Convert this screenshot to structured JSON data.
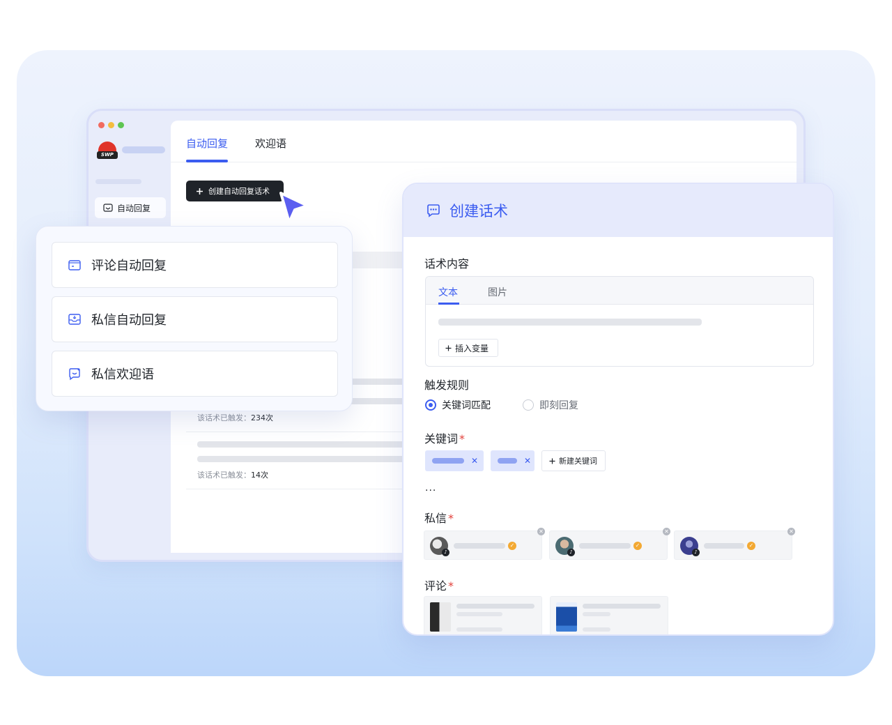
{
  "window": {
    "nav_item_label": "自动回复"
  },
  "logo": {
    "text": "SWP"
  },
  "top_tabs": [
    {
      "label": "自动回复",
      "active": true
    },
    {
      "label": "欢迎语",
      "active": false
    }
  ],
  "create_button_label": "创建自动回复话术",
  "list": [
    {
      "trigger_label": "该话术已触发：",
      "trigger_count": "234次"
    },
    {
      "trigger_label": "该话术已触发：",
      "trigger_count": "14次"
    }
  ],
  "options": [
    {
      "label": "评论自动回复",
      "icon": "comment-icon"
    },
    {
      "label": "私信自动回复",
      "icon": "inbox-icon"
    },
    {
      "label": "私信欢迎语",
      "icon": "welcome-icon"
    }
  ],
  "create_panel": {
    "title": "创建话术",
    "content_section": {
      "label": "话术内容",
      "tabs": [
        {
          "label": "文本",
          "active": true
        },
        {
          "label": "图片",
          "active": false
        }
      ],
      "insert_variable_label": "插入变量"
    },
    "trigger_section": {
      "label": "触发规则",
      "options": [
        {
          "label": "关键词匹配",
          "checked": true
        },
        {
          "label": "即刻回复",
          "checked": false
        }
      ]
    },
    "keyword_section": {
      "label": "关键词",
      "required_mark": "*",
      "new_keyword_label": "新建关键词"
    },
    "ellipsis": "...",
    "dm_section": {
      "label": "私信",
      "required_mark": "*"
    },
    "comment_section": {
      "label": "评论",
      "required_mark": "*"
    }
  },
  "colors": {
    "accent": "#3b5cf0",
    "required": "#e2403a",
    "verify": "#f3a933"
  }
}
